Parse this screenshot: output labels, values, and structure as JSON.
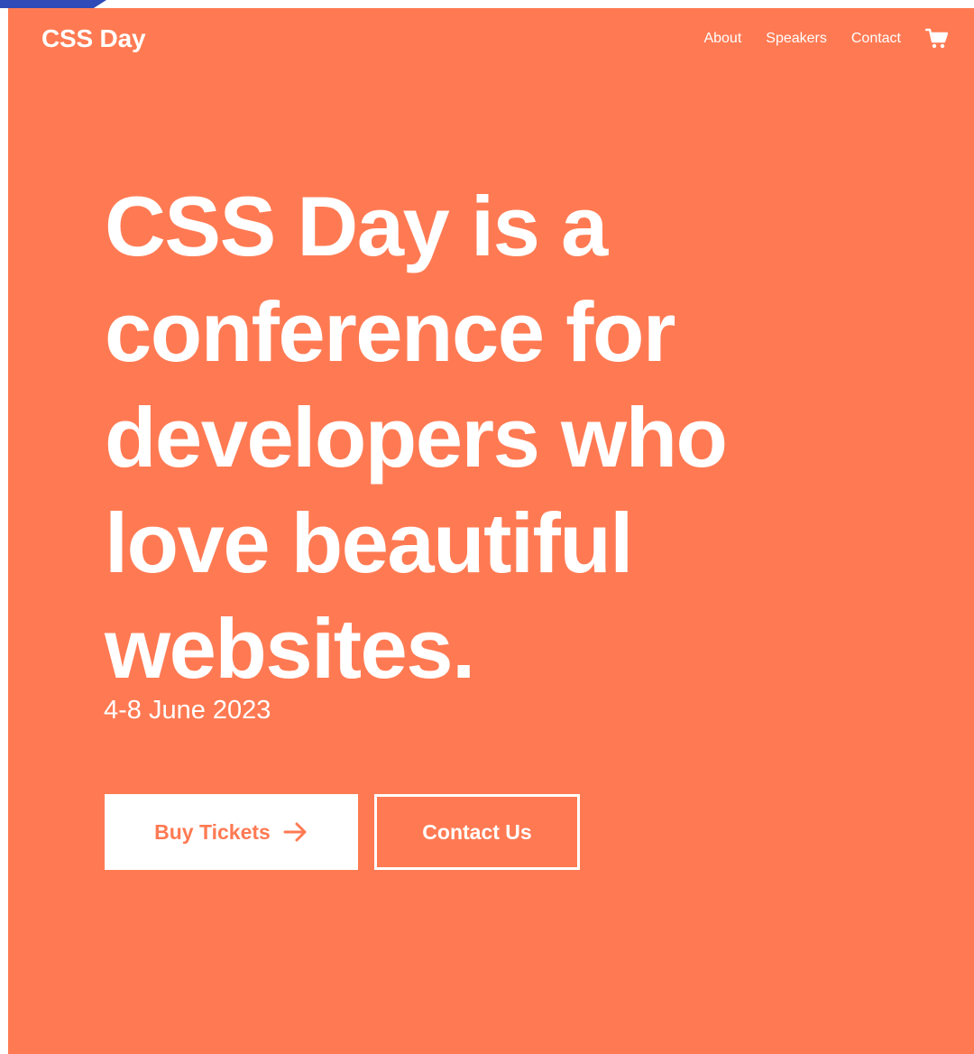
{
  "header": {
    "logo": "CSS Day",
    "nav": [
      {
        "label": "About"
      },
      {
        "label": "Speakers"
      },
      {
        "label": "Contact"
      }
    ],
    "cart_icon": "shopping-cart-icon"
  },
  "hero": {
    "headline_lines": [
      "CSS Day is a",
      "conference for",
      "developers who",
      "love beautiful",
      "websites."
    ],
    "date": "4-8 June 2023",
    "primary_button": {
      "label": "Buy Tickets",
      "icon": "arrow-right-icon"
    },
    "secondary_button": {
      "label": "Contact Us"
    }
  },
  "colors": {
    "background": "#ff7a53",
    "text": "#ffffff",
    "accent_corner": "#2f4bb7"
  }
}
